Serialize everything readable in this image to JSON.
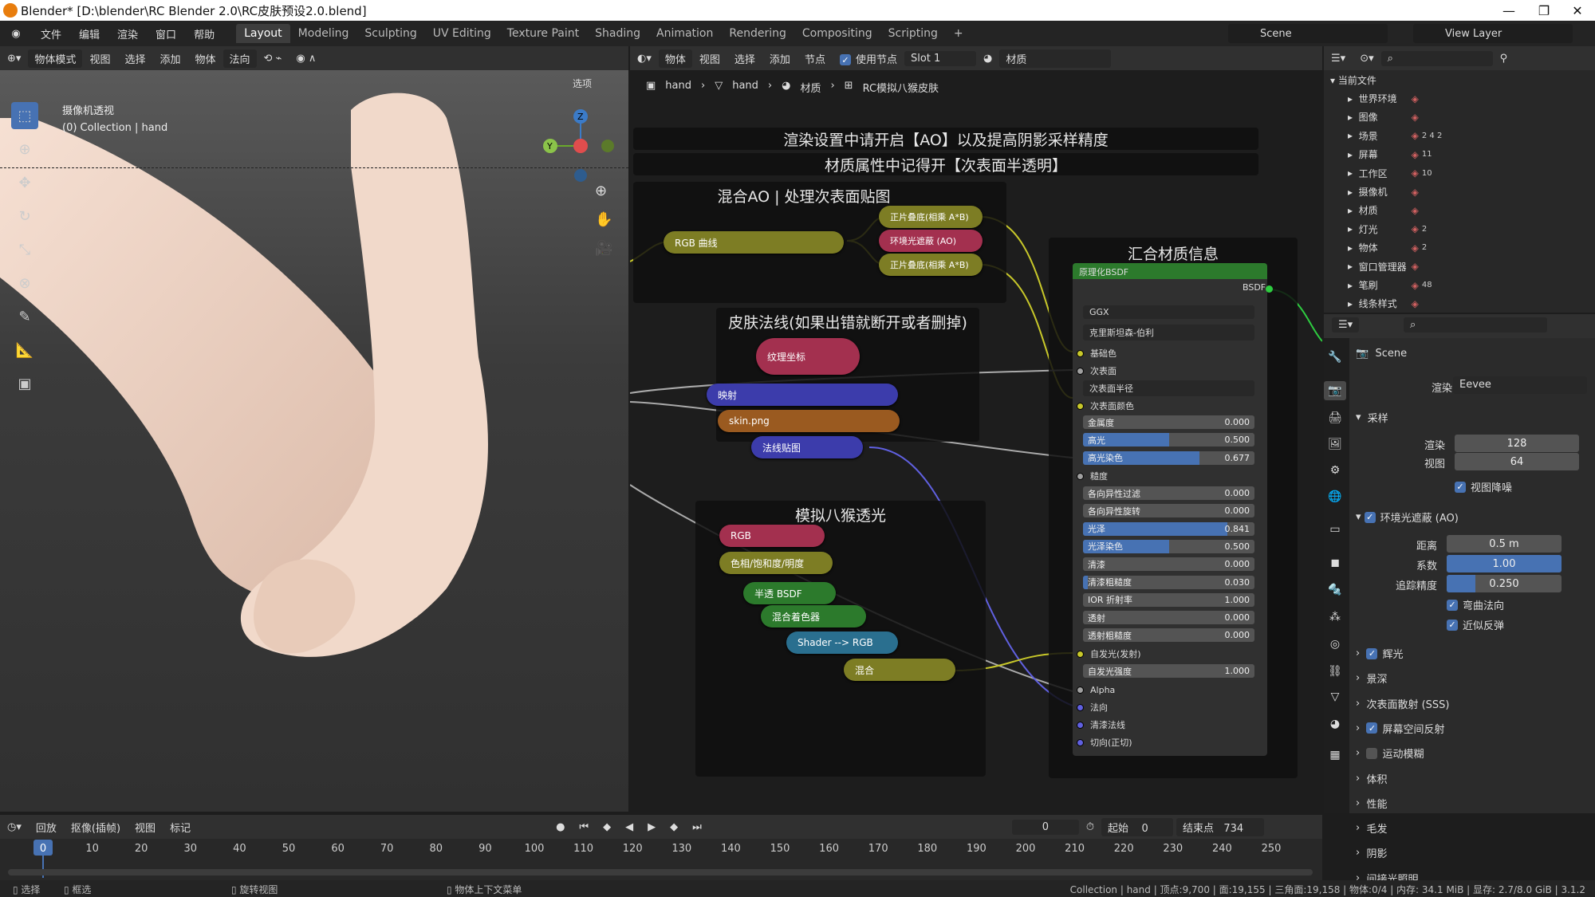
{
  "window": {
    "title": "Blender* [D:\\blender\\RC Blender 2.0\\RC皮肤预设2.0.blend]"
  },
  "menu": [
    "文件",
    "编辑",
    "渲染",
    "窗口",
    "帮助"
  ],
  "workspaces": [
    "Layout",
    "Modeling",
    "Sculpting",
    "UV Editing",
    "Texture Paint",
    "Shading",
    "Animation",
    "Rendering",
    "Compositing",
    "Scripting"
  ],
  "scene": {
    "name": "Scene",
    "view_layer": "View Layer"
  },
  "viewport": {
    "header": {
      "mode": "物体模式",
      "view": "视图",
      "select": "选择",
      "add": "添加",
      "object": "物体",
      "orientation": "法向",
      "options": "选项"
    },
    "overlay_line1": "摄像机透视",
    "overlay_line2": "(0) Collection | hand",
    "gizmo": {
      "x": "",
      "y": "Y",
      "z": "Z"
    }
  },
  "node_editor": {
    "header": {
      "type": "物体",
      "view": "视图",
      "select": "选择",
      "add": "添加",
      "node": "节点",
      "use_nodes": "使用节点",
      "slot": "Slot 1",
      "material": "材质"
    },
    "breadcrumb": [
      "hand",
      "hand",
      "材质",
      "RC模拟八猴皮肤"
    ],
    "note1": "渲染设置中请开启【AO】以及提高阴影采样精度",
    "note2": "材质属性中记得开【次表面半透明】",
    "frame_ao": "混合AO | 处理次表面贴图",
    "frame_normal": "皮肤法线(如果出错就断开或者删掉)",
    "frame_marmoset": "模拟八猴透光",
    "frame_summary": "汇合材质信息",
    "nodes": {
      "rgb_curve": "RGB 曲线",
      "mult1": "正片叠底(相乘 A*B)",
      "ao": "环境光遮蔽 (AO)",
      "mult2": "正片叠底(相乘 A*B)",
      "texcoord": "纹理坐标",
      "mapping": "映射",
      "skin": "skin.png",
      "normalmap": "法线贴图",
      "rgb": "RGB",
      "hsv": "色相/饱和度/明度",
      "translucent": "半透 BSDF",
      "mixshader": "混合着色器",
      "shader2rgb": "Shader --> RGB",
      "mix": "混合"
    },
    "bsdf": {
      "title": "原理化BSDF",
      "output": "BSDF",
      "distribution": "GGX",
      "subsurface_method": "克里斯坦森-伯利",
      "base_color": "基础色",
      "subsurface": "次表面",
      "subsurface_radius": "次表面半径",
      "subsurface_color": "次表面颜色",
      "sliders": [
        {
          "label": "金属度",
          "value": "0.000",
          "fill": 0
        },
        {
          "label": "高光",
          "value": "0.500",
          "fill": 0.5
        },
        {
          "label": "高光染色",
          "value": "0.677",
          "fill": 0.677
        }
      ],
      "roughness": "糙度",
      "sliders2": [
        {
          "label": "各向异性过滤",
          "value": "0.000",
          "fill": 0
        },
        {
          "label": "各向异性旋转",
          "value": "0.000",
          "fill": 0
        },
        {
          "label": "光泽",
          "value": "0.841",
          "fill": 0.841
        },
        {
          "label": "光泽染色",
          "value": "0.500",
          "fill": 0.5
        },
        {
          "label": "清漆",
          "value": "0.000",
          "fill": 0
        },
        {
          "label": "清漆粗糙度",
          "value": "0.030",
          "fill": 0.03
        },
        {
          "label": "IOR 折射率",
          "value": "1.000",
          "fill": 0
        },
        {
          "label": "透射",
          "value": "0.000",
          "fill": 0
        },
        {
          "label": "透射粗糙度",
          "value": "0.000",
          "fill": 0
        }
      ],
      "emission": "自发光(发射)",
      "emission_strength": {
        "label": "自发光强度",
        "value": "1.000"
      },
      "alpha": "Alpha",
      "normal": "法向",
      "clearcoat_normal": "清漆法线",
      "tangent": "切向(正切)"
    }
  },
  "outliner": {
    "title": "当前文件",
    "items": [
      {
        "label": "世界环境",
        "icons": "",
        "badge": ""
      },
      {
        "label": "图像",
        "icons": "",
        "badge": ""
      },
      {
        "label": "场景",
        "icons": "",
        "badge": "2 4 2"
      },
      {
        "label": "屏幕",
        "icons": "",
        "badge": "11"
      },
      {
        "label": "工作区",
        "icons": "",
        "badge": "10"
      },
      {
        "label": "摄像机",
        "icons": "",
        "badge": ""
      },
      {
        "label": "材质",
        "icons": "",
        "badge": ""
      },
      {
        "label": "灯光",
        "icons": "",
        "badge": "2"
      },
      {
        "label": "物体",
        "icons": "",
        "badge": "2"
      },
      {
        "label": "窗口管理器",
        "icons": "",
        "badge": ""
      },
      {
        "label": "笔刷",
        "icons": "",
        "badge": "48"
      },
      {
        "label": "线条样式",
        "icons": "",
        "badge": ""
      }
    ]
  },
  "properties": {
    "scene": "Scene",
    "engine_label": "渲染引擎",
    "engine": "Eevee",
    "sampling": "采样",
    "render_label": "渲染",
    "render_value": "128",
    "viewport_label": "视图",
    "viewport_value": "64",
    "denoise": "视图降噪",
    "ao": "环境光遮蔽 (AO)",
    "distance_label": "距离",
    "distance": "0.5 m",
    "factor_label": "系数",
    "factor": "1.00",
    "factor_fill": 1.0,
    "trace_label": "追踪精度",
    "trace": "0.250",
    "trace_fill": 0.25,
    "bent": "弯曲法向",
    "bounce": "近似反弹",
    "panels": [
      {
        "label": "辉光",
        "check": true
      },
      {
        "label": "景深",
        "check": null
      },
      {
        "label": "次表面散射 (SSS)",
        "check": null
      },
      {
        "label": "屏幕空间反射",
        "check": true
      },
      {
        "label": "运动模糊",
        "check": false
      },
      {
        "label": "体积",
        "check": null
      },
      {
        "label": "性能",
        "check": null
      },
      {
        "label": "毛发",
        "check": null
      },
      {
        "label": "阴影",
        "check": null
      },
      {
        "label": "间接光照明",
        "check": null
      }
    ]
  },
  "timeline": {
    "playback": "回放",
    "keying": "抠像(插帧)",
    "view": "视图",
    "marker": "标记",
    "current": "0",
    "start_label": "起始",
    "start": "0",
    "end_label": "结束点",
    "end": "734",
    "ticks": [
      "0",
      "10",
      "20",
      "30",
      "40",
      "50",
      "60",
      "70",
      "80",
      "90",
      "100",
      "110",
      "120",
      "130",
      "140",
      "150",
      "160",
      "170",
      "180",
      "190",
      "200",
      "210",
      "220",
      "230",
      "240",
      "250"
    ]
  },
  "status": {
    "select": "选择",
    "box": "框选",
    "rotate": "旋转视图",
    "context": "物体上下文菜单",
    "stats": "Collection | hand | 顶点:9,700 | 面:19,155 | 三角面:19,158 | 物体:0/4 | 内存: 34.1 MiB | 显存: 2.7/8.0 GiB | 3.1.2"
  },
  "colors": {
    "accent": "#4772b3",
    "node_yellow": "#7d7d24",
    "node_pink": "#a3304f",
    "node_blue": "#3c3cab",
    "node_orange": "#9a5a20",
    "node_green": "#2c7a2c",
    "node_teal": "#2a6f8f"
  }
}
